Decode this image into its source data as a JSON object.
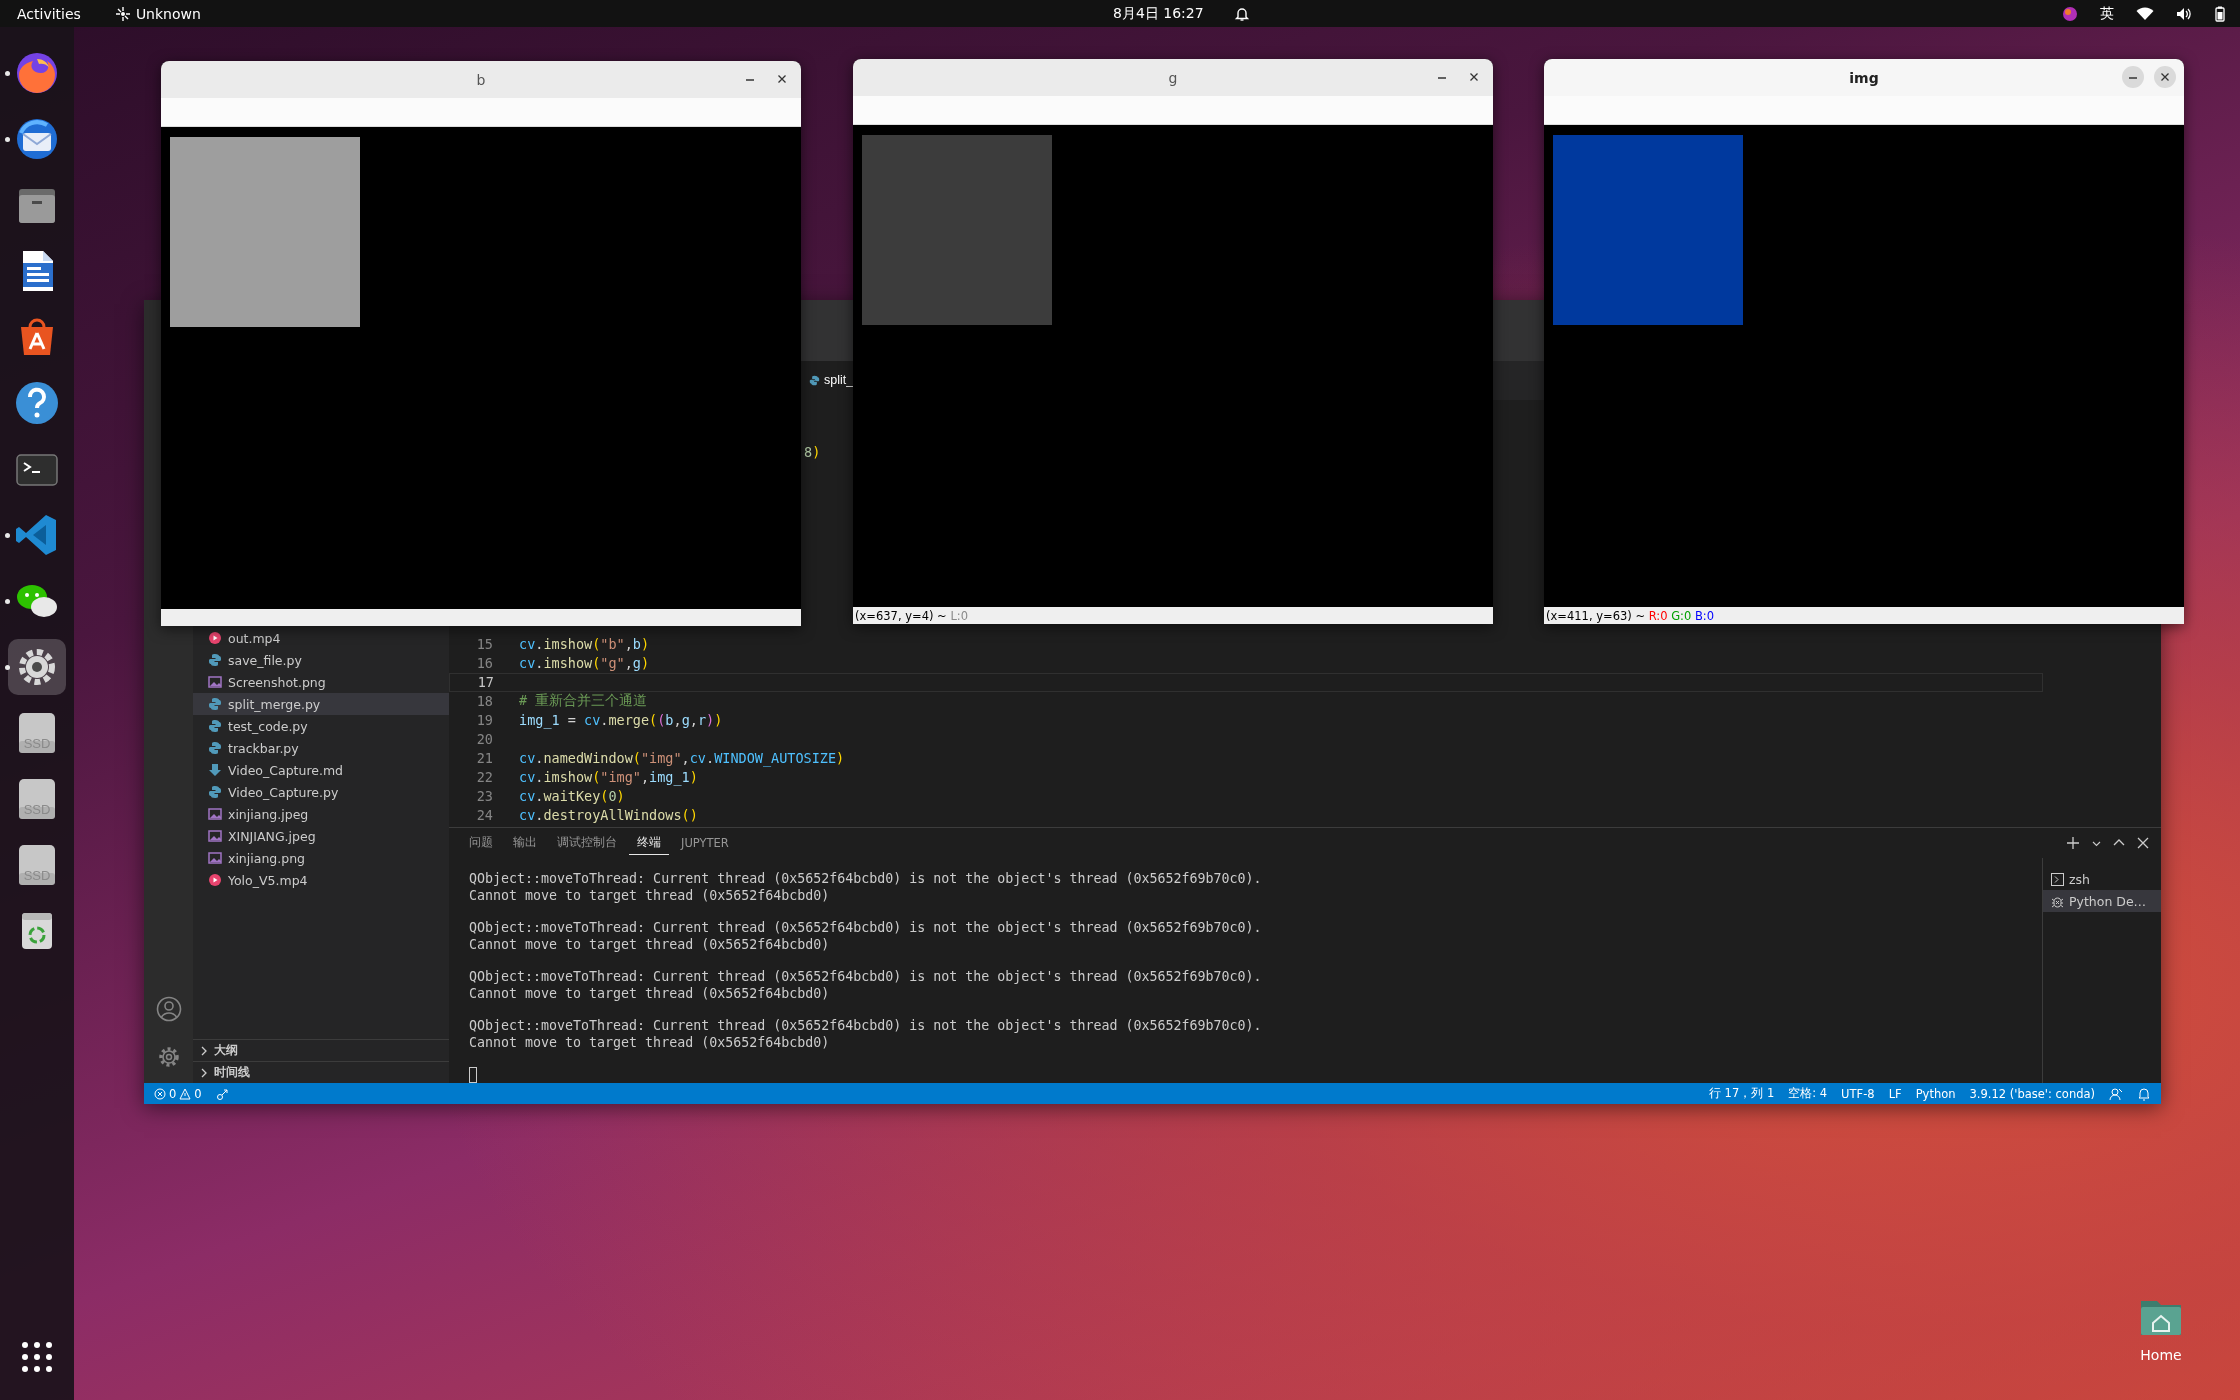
{
  "top_bar": {
    "activities": "Activities",
    "app_name": "Unknown",
    "clock": "8月4日 16:27",
    "input_method": "英"
  },
  "dock": {
    "items": [
      {
        "kind": "browser",
        "running": true,
        "selected": false
      },
      {
        "kind": "mail",
        "running": true,
        "selected": false
      },
      {
        "kind": "files",
        "running": false,
        "selected": false
      },
      {
        "kind": "writer",
        "running": false,
        "selected": false
      },
      {
        "kind": "store",
        "running": false,
        "selected": false
      },
      {
        "kind": "help",
        "running": false,
        "selected": false
      },
      {
        "kind": "terminal",
        "running": false,
        "selected": false
      },
      {
        "kind": "code",
        "running": true,
        "selected": false
      },
      {
        "kind": "chat",
        "running": true,
        "selected": false
      },
      {
        "kind": "settings",
        "running": true,
        "selected": true
      },
      {
        "kind": "drive",
        "label": "SSD",
        "running": false,
        "selected": false
      },
      {
        "kind": "drive",
        "label": "SSD",
        "running": false,
        "selected": false
      },
      {
        "kind": "drive",
        "label": "SSD",
        "running": false,
        "selected": false
      },
      {
        "kind": "trash",
        "running": false,
        "selected": false
      }
    ]
  },
  "vscode": {
    "tabs": [
      {
        "label": "split_",
        "selected": true
      }
    ],
    "code_fragment": [
      {
        "kind": "num",
        "t": "8"
      },
      {
        "kind": "b1",
        "t": ")"
      }
    ],
    "code_lines": [
      {
        "number": "15",
        "current": false,
        "tokens": [
          {
            "kind": "ns",
            "t": "cv"
          },
          {
            "kind": "p",
            "t": "."
          },
          {
            "kind": "fn",
            "t": "imshow"
          },
          {
            "kind": "b1",
            "t": "("
          },
          {
            "kind": "str",
            "t": "\"b\""
          },
          {
            "kind": "p",
            "t": ","
          },
          {
            "kind": "var",
            "t": "b"
          },
          {
            "kind": "b1",
            "t": ")"
          }
        ]
      },
      {
        "number": "16",
        "current": false,
        "tokens": [
          {
            "kind": "ns",
            "t": "cv"
          },
          {
            "kind": "p",
            "t": "."
          },
          {
            "kind": "fn",
            "t": "imshow"
          },
          {
            "kind": "b1",
            "t": "("
          },
          {
            "kind": "str",
            "t": "\"g\""
          },
          {
            "kind": "p",
            "t": ","
          },
          {
            "kind": "var",
            "t": "g"
          },
          {
            "kind": "b1",
            "t": ")"
          }
        ]
      },
      {
        "number": "17",
        "current": true
      },
      {
        "number": "18",
        "current": false,
        "tokens": [
          {
            "kind": "comment",
            "t": "# 重新合并三个通道"
          }
        ]
      },
      {
        "number": "19",
        "current": false,
        "tokens": [
          {
            "kind": "var",
            "t": "img_1"
          },
          {
            "kind": "p",
            "t": " = "
          },
          {
            "kind": "ns",
            "t": "cv"
          },
          {
            "kind": "p",
            "t": "."
          },
          {
            "kind": "fn",
            "t": "merge"
          },
          {
            "kind": "b1",
            "t": "("
          },
          {
            "kind": "b2",
            "t": "("
          },
          {
            "kind": "var",
            "t": "b"
          },
          {
            "kind": "p",
            "t": ","
          },
          {
            "kind": "var",
            "t": "g"
          },
          {
            "kind": "p",
            "t": ","
          },
          {
            "kind": "var",
            "t": "r"
          },
          {
            "kind": "b2",
            "t": ")"
          },
          {
            "kind": "b1",
            "t": ")"
          }
        ]
      },
      {
        "number": "20",
        "current": false
      },
      {
        "number": "21",
        "current": false,
        "tokens": [
          {
            "kind": "ns",
            "t": "cv"
          },
          {
            "kind": "p",
            "t": "."
          },
          {
            "kind": "fn",
            "t": "namedWindow"
          },
          {
            "kind": "b1",
            "t": "("
          },
          {
            "kind": "str",
            "t": "\"img\""
          },
          {
            "kind": "p",
            "t": ","
          },
          {
            "kind": "ns",
            "t": "cv"
          },
          {
            "kind": "p",
            "t": "."
          },
          {
            "kind": "const",
            "t": "WINDOW_AUTOSIZE"
          },
          {
            "kind": "b1",
            "t": ")"
          }
        ]
      },
      {
        "number": "22",
        "current": false,
        "tokens": [
          {
            "kind": "ns",
            "t": "cv"
          },
          {
            "kind": "p",
            "t": "."
          },
          {
            "kind": "fn",
            "t": "imshow"
          },
          {
            "kind": "b1",
            "t": "("
          },
          {
            "kind": "str",
            "t": "\"img\""
          },
          {
            "kind": "p",
            "t": ","
          },
          {
            "kind": "var",
            "t": "img_1"
          },
          {
            "kind": "b1",
            "t": ")"
          }
        ]
      },
      {
        "number": "23",
        "current": false,
        "tokens": [
          {
            "kind": "ns",
            "t": "cv"
          },
          {
            "kind": "p",
            "t": "."
          },
          {
            "kind": "fn",
            "t": "waitKey"
          },
          {
            "kind": "b1",
            "t": "("
          },
          {
            "kind": "num",
            "t": "0"
          },
          {
            "kind": "b1",
            "t": ")"
          }
        ]
      },
      {
        "number": "24",
        "current": false,
        "tokens": [
          {
            "kind": "ns",
            "t": "cv"
          },
          {
            "kind": "p",
            "t": "."
          },
          {
            "kind": "fn",
            "t": "destroyAllWindows"
          },
          {
            "kind": "b1",
            "t": "()"
          }
        ]
      }
    ],
    "explorer": {
      "files": [
        {
          "name": "out.mp4",
          "kind": "video",
          "selected": false
        },
        {
          "name": "save_file.py",
          "kind": "python",
          "selected": false
        },
        {
          "name": "Screenshot.png",
          "kind": "image",
          "selected": false
        },
        {
          "name": "split_merge.py",
          "kind": "python",
          "selected": true
        },
        {
          "name": "test_code.py",
          "kind": "python",
          "selected": false
        },
        {
          "name": "trackbar.py",
          "kind": "python",
          "selected": false
        },
        {
          "name": "Video_Capture.md",
          "kind": "markdown",
          "selected": false
        },
        {
          "name": "Video_Capture.py",
          "kind": "python",
          "selected": false
        },
        {
          "name": "xinjiang.jpeg",
          "kind": "image",
          "selected": false
        },
        {
          "name": "XINJIANG.jpeg",
          "kind": "image",
          "selected": false
        },
        {
          "name": "xinjiang.png",
          "kind": "image",
          "selected": false
        },
        {
          "name": "Yolo_V5.mp4",
          "kind": "video",
          "selected": false
        }
      ],
      "sections": [
        {
          "label": "大纲",
          "expanded": false
        },
        {
          "label": "时间线",
          "expanded": false
        }
      ]
    },
    "panel": {
      "tabs": [
        {
          "label": "问题",
          "selected": false
        },
        {
          "label": "输出",
          "selected": false
        },
        {
          "label": "调试控制台",
          "selected": false
        },
        {
          "label": "终端",
          "selected": true
        },
        {
          "label": "JUPYTER",
          "selected": false
        }
      ],
      "terminal_output": [
        {
          "lines": [
            "QObject::moveToThread: Current thread (0x5652f64bcbd0) is not the object's thread (0x5652f69b70c0).",
            "Cannot move to target thread (0x5652f64bcbd0)"
          ]
        },
        {
          "lines": [
            "QObject::moveToThread: Current thread (0x5652f64bcbd0) is not the object's thread (0x5652f69b70c0).",
            "Cannot move to target thread (0x5652f64bcbd0)"
          ]
        },
        {
          "lines": [
            "QObject::moveToThread: Current thread (0x5652f64bcbd0) is not the object's thread (0x5652f69b70c0).",
            "Cannot move to target thread (0x5652f64bcbd0)"
          ]
        },
        {
          "lines": [
            "QObject::moveToThread: Current thread (0x5652f64bcbd0) is not the object's thread (0x5652f69b70c0).",
            "Cannot move to target thread (0x5652f64bcbd0)"
          ]
        }
      ],
      "terminals": [
        {
          "label": "zsh",
          "kind": "shell",
          "selected": false
        },
        {
          "label": "Python De…",
          "kind": "debug",
          "selected": true
        }
      ]
    },
    "status_bar": {
      "errors": "0",
      "warnings": "0",
      "items": [
        "行 17，列 1",
        "空格: 4",
        "UTF-8",
        "LF",
        "Python",
        "3.9.12 ('base': conda)"
      ]
    }
  },
  "cv_windows": [
    {
      "title": "b",
      "focused": false,
      "color": "#9e9e9e"
    },
    {
      "title": "g",
      "focused": false,
      "color": "#3c3c3c",
      "status": [
        {
          "text": "(x=637, y=4) ~",
          "color": "#000000"
        },
        {
          "text": "L:0",
          "color": "#8a8a8a"
        }
      ]
    },
    {
      "title": "img",
      "focused": true,
      "color": "#00399e",
      "status": [
        {
          "text": "(x=411, y=63) ~",
          "color": "#000000"
        },
        {
          "text": "R:0",
          "color": "#ff0000"
        },
        {
          "text": "G:0",
          "color": "#00a000"
        },
        {
          "text": "B:0",
          "color": "#0000ff"
        }
      ]
    }
  ],
  "desktop_icons": [
    {
      "label": "Home"
    }
  ]
}
